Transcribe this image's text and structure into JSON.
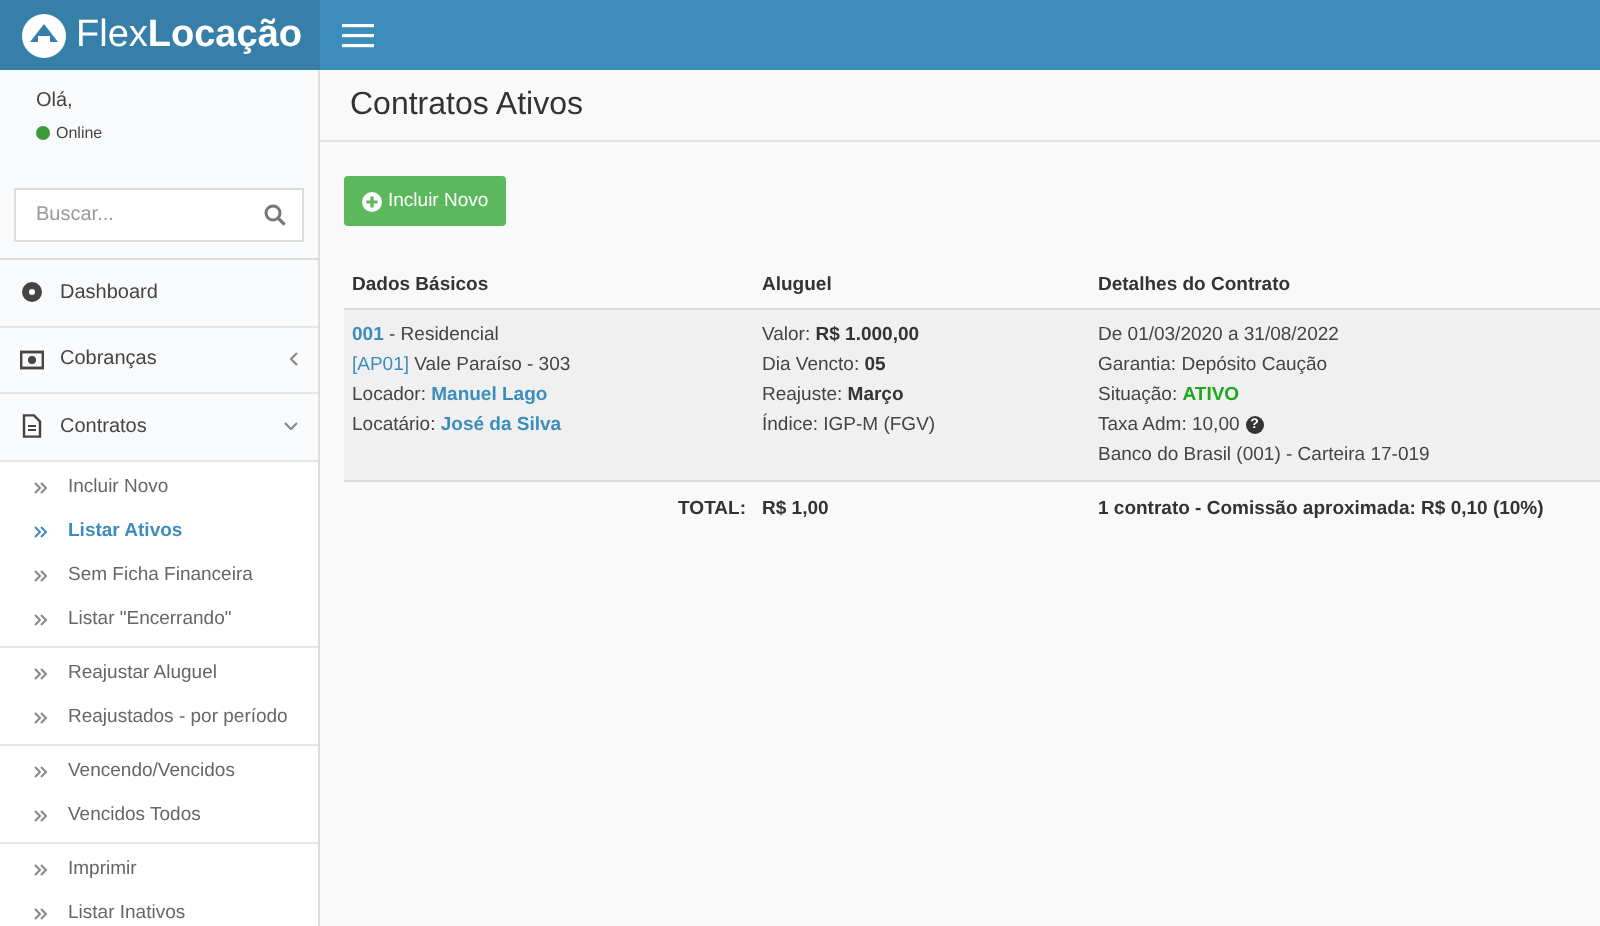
{
  "header": {
    "logo_light": "Flex",
    "logo_bold": "Locação"
  },
  "sidebar": {
    "greeting": "Olá,",
    "status": {
      "label": "Online",
      "color": "#3c9a3c"
    },
    "search": {
      "placeholder": "Buscar..."
    },
    "menu": [
      {
        "kind": "dashboard",
        "label": "Dashboard"
      },
      {
        "kind": "billing",
        "label": "Cobranças",
        "expanded": false
      },
      {
        "kind": "document",
        "label": "Contratos",
        "expanded": true,
        "groups": [
          [
            {
              "label": "Incluir Novo",
              "selected": false
            },
            {
              "label": "Listar Ativos",
              "selected": true
            },
            {
              "label": "Sem Ficha Financeira",
              "selected": false
            },
            {
              "label": "Listar \"Encerrando\"",
              "selected": false
            }
          ],
          [
            {
              "label": "Reajustar Aluguel",
              "selected": false
            },
            {
              "label": "Reajustados - por período",
              "selected": false
            }
          ],
          [
            {
              "label": "Vencendo/Vencidos",
              "selected": false
            },
            {
              "label": "Vencidos Todos",
              "selected": false
            }
          ],
          [
            {
              "label": "Imprimir",
              "selected": false
            },
            {
              "label": "Listar Inativos",
              "selected": false
            }
          ]
        ]
      }
    ]
  },
  "page": {
    "title": "Contratos Ativos",
    "new_button": "Incluir Novo",
    "table": {
      "columns": [
        "Dados Básicos",
        "Aluguel",
        "Detalhes do Contrato"
      ],
      "rows": [
        [
          [
            [
              {
                "kind": "link",
                "text": "001"
              },
              {
                "kind": "plain",
                "text": " - Residencial"
              }
            ],
            [
              {
                "kind": "link-light",
                "text": "[AP01]"
              },
              {
                "kind": "plain",
                "text": " Vale Paraíso - 303"
              }
            ],
            [
              {
                "kind": "plain",
                "text": "Locador: "
              },
              {
                "kind": "link",
                "text": "Manuel Lago"
              }
            ],
            [
              {
                "kind": "plain",
                "text": "Locatário: "
              },
              {
                "kind": "link",
                "text": "José da Silva"
              }
            ]
          ],
          [
            [
              {
                "kind": "plain",
                "text": "Valor: "
              },
              {
                "kind": "bold",
                "text": "R$ 1.000,00"
              }
            ],
            [
              {
                "kind": "plain",
                "text": "Dia Vencto: "
              },
              {
                "kind": "bold",
                "text": "05"
              }
            ],
            [
              {
                "kind": "plain",
                "text": "Reajuste: "
              },
              {
                "kind": "bold",
                "text": "Março"
              }
            ],
            [
              {
                "kind": "plain",
                "text": "Índice: IGP-M (FGV)"
              }
            ]
          ],
          [
            [
              {
                "kind": "plain",
                "text": "De 01/03/2020 a 31/08/2022"
              }
            ],
            [
              {
                "kind": "plain",
                "text": "Garantia: Depósito Caução"
              }
            ],
            [
              {
                "kind": "plain",
                "text": "Situação: "
              },
              {
                "kind": "ok",
                "text": "ATIVO"
              }
            ],
            [
              {
                "kind": "plain",
                "text": "Taxa Adm: 10,00"
              },
              {
                "kind": "help",
                "text": "?"
              }
            ],
            [
              {
                "kind": "plain",
                "text": "Banco do Brasil (001) - Carteira 17-019"
              }
            ]
          ]
        ]
      ],
      "total_label": "TOTAL:",
      "total_value": "R$ 1,00",
      "summary": "1 contrato - Comissão aproximada: R$ 0,10 (10%)"
    }
  }
}
